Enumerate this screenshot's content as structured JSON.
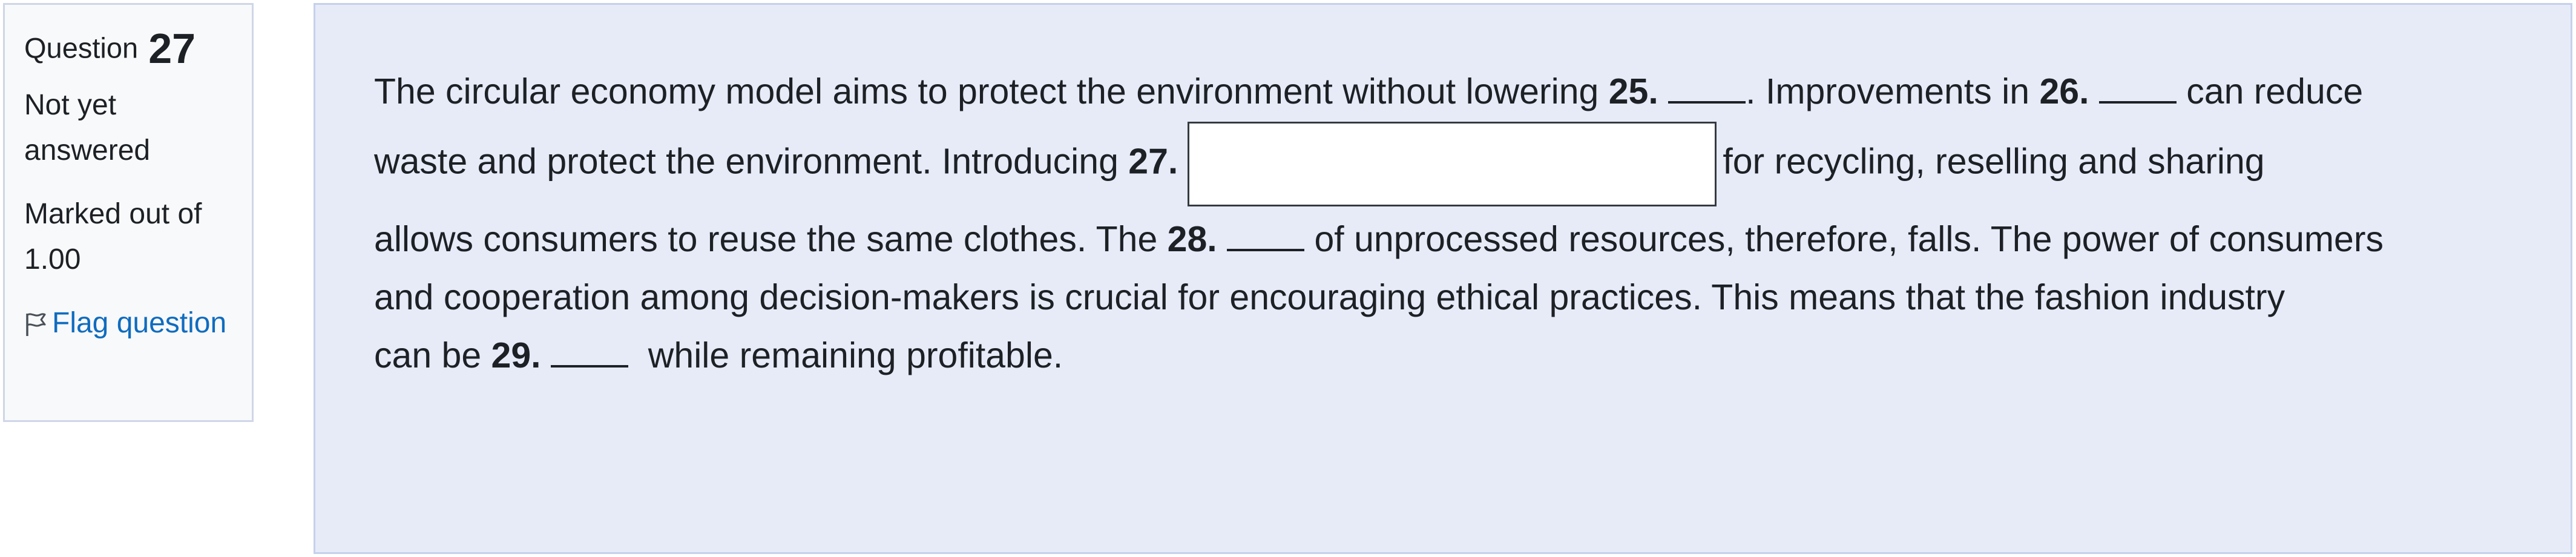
{
  "question_info": {
    "label": "Question",
    "number": "27",
    "status": "Not yet answered",
    "marks": "Marked out of 1.00",
    "flag_label": "Flag question"
  },
  "passage": {
    "line1": {
      "text_a": "The circular economy model aims to protect the environment without lowering ",
      "num_a": "25.",
      "text_b": ". Improvements in ",
      "num_b": "26.",
      "text_c": " can reduce"
    },
    "line2": {
      "text_a": "waste and protect the environment. Introducing ",
      "num_a": "27.",
      "text_b": "for recycling, reselling and sharing"
    },
    "line3": {
      "text_a": "allows consumers to reuse the same clothes. The ",
      "num_a": "28.",
      "text_b": " of unprocessed resources, therefore, falls. The power of consumers"
    },
    "line4": {
      "text_a": "and cooperation among decision-makers is crucial for encouraging ethical practices. This means that the fashion industry"
    },
    "line5": {
      "text_a": "can be ",
      "num_a": "29.",
      "text_b": "  while remaining profitable."
    }
  },
  "answer_field": {
    "value": "",
    "placeholder": ""
  }
}
